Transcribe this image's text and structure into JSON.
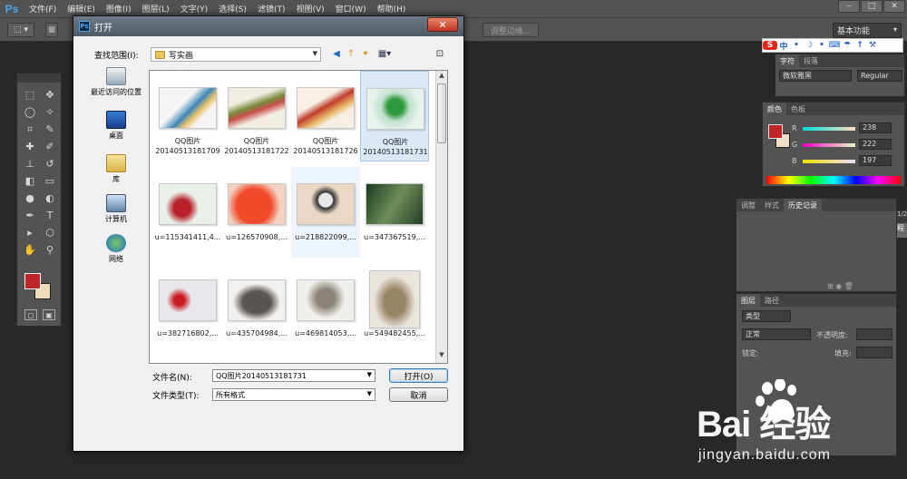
{
  "menubar": {
    "logo": "Ps",
    "items": [
      "文件(F)",
      "编辑(E)",
      "图像(I)",
      "图层(L)",
      "文字(Y)",
      "选择(S)",
      "滤镜(T)",
      "视图(V)",
      "窗口(W)",
      "帮助(H)"
    ],
    "min": "–",
    "max": "□",
    "close": "✕"
  },
  "optionsbar": {
    "refine_edge": "调整边缘...",
    "workspace": "基本功能"
  },
  "dialog": {
    "title": "打开",
    "look_in_label": "查找范围(I):",
    "look_in_value": "写实画",
    "places": [
      "最近访问的位置",
      "桌面",
      "库",
      "计算机",
      "网络"
    ],
    "files": [
      {
        "name": "QQ图片",
        "sub": "20140513181709"
      },
      {
        "name": "QQ图片",
        "sub": "20140513181722"
      },
      {
        "name": "QQ图片",
        "sub": "20140513181726"
      },
      {
        "name": "QQ图片",
        "sub": "20140513181731"
      },
      {
        "name": "u=115341411,4...",
        "sub": ""
      },
      {
        "name": "u=126570908,...",
        "sub": ""
      },
      {
        "name": "u=218822099,...",
        "sub": ""
      },
      {
        "name": "u=347367519,...",
        "sub": ""
      },
      {
        "name": "u=382716802,...",
        "sub": ""
      },
      {
        "name": "u=435704984,...",
        "sub": ""
      },
      {
        "name": "u=469814053,...",
        "sub": ""
      },
      {
        "name": "u=549482455,...",
        "sub": ""
      }
    ],
    "filename_label": "文件名(N):",
    "filename_value": "QQ图片20140513181731",
    "filetype_label": "文件类型(T):",
    "filetype_value": "所有格式",
    "open_button": "打开(O)",
    "cancel_button": "取消"
  },
  "char_panel": {
    "tabs": [
      "字符",
      "段落"
    ],
    "font": "微软雅黑",
    "style": "Regular"
  },
  "color_panel": {
    "tabs": [
      "颜色",
      "色板"
    ],
    "r_label": "R",
    "g_label": "G",
    "b_label": "B",
    "r": "238",
    "g": "222",
    "b": "197"
  },
  "history_panel": {
    "tabs": [
      "调整",
      "样式",
      "历史记录"
    ]
  },
  "layers_panel": {
    "tabs": [
      "图层",
      "路径"
    ],
    "kind": "类型",
    "blend": "正常",
    "opacity_label": "不透明度:",
    "lock_label": "锁定:",
    "fill_label": "填充:"
  },
  "side_char": "1/2",
  "side_char2": "程",
  "ime": {
    "s": "S",
    "items": [
      "中",
      "•",
      "☽",
      "•",
      "⌨",
      "☂",
      "↑",
      "⚒"
    ]
  },
  "watermark": {
    "big": "Bai  经验",
    "small": "jingyan.baidu.com"
  }
}
